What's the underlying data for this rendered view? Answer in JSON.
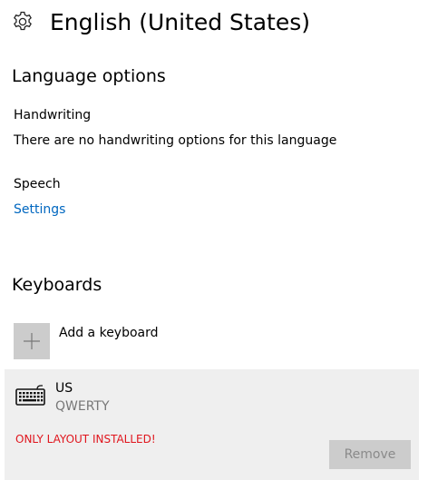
{
  "header": {
    "icon": "gear-icon",
    "title": "English (United States)"
  },
  "language_options": {
    "title": "Language options",
    "handwriting": {
      "label": "Handwriting",
      "description": "There are no handwriting options for this language"
    },
    "speech": {
      "label": "Speech",
      "link": "Settings"
    }
  },
  "keyboards": {
    "title": "Keyboards",
    "add_label": "Add a keyboard",
    "items": [
      {
        "icon": "keyboard-icon",
        "name": "US",
        "layout": "QWERTY",
        "warning": "ONLY LAYOUT INSTALLED!",
        "remove_label": "Remove",
        "remove_enabled": false
      }
    ]
  },
  "colors": {
    "link": "#0067c0",
    "warning": "#e0151d",
    "item_background": "#efefef",
    "button_disabled_bg": "#cccccc",
    "button_disabled_text": "#8a8a8a"
  }
}
